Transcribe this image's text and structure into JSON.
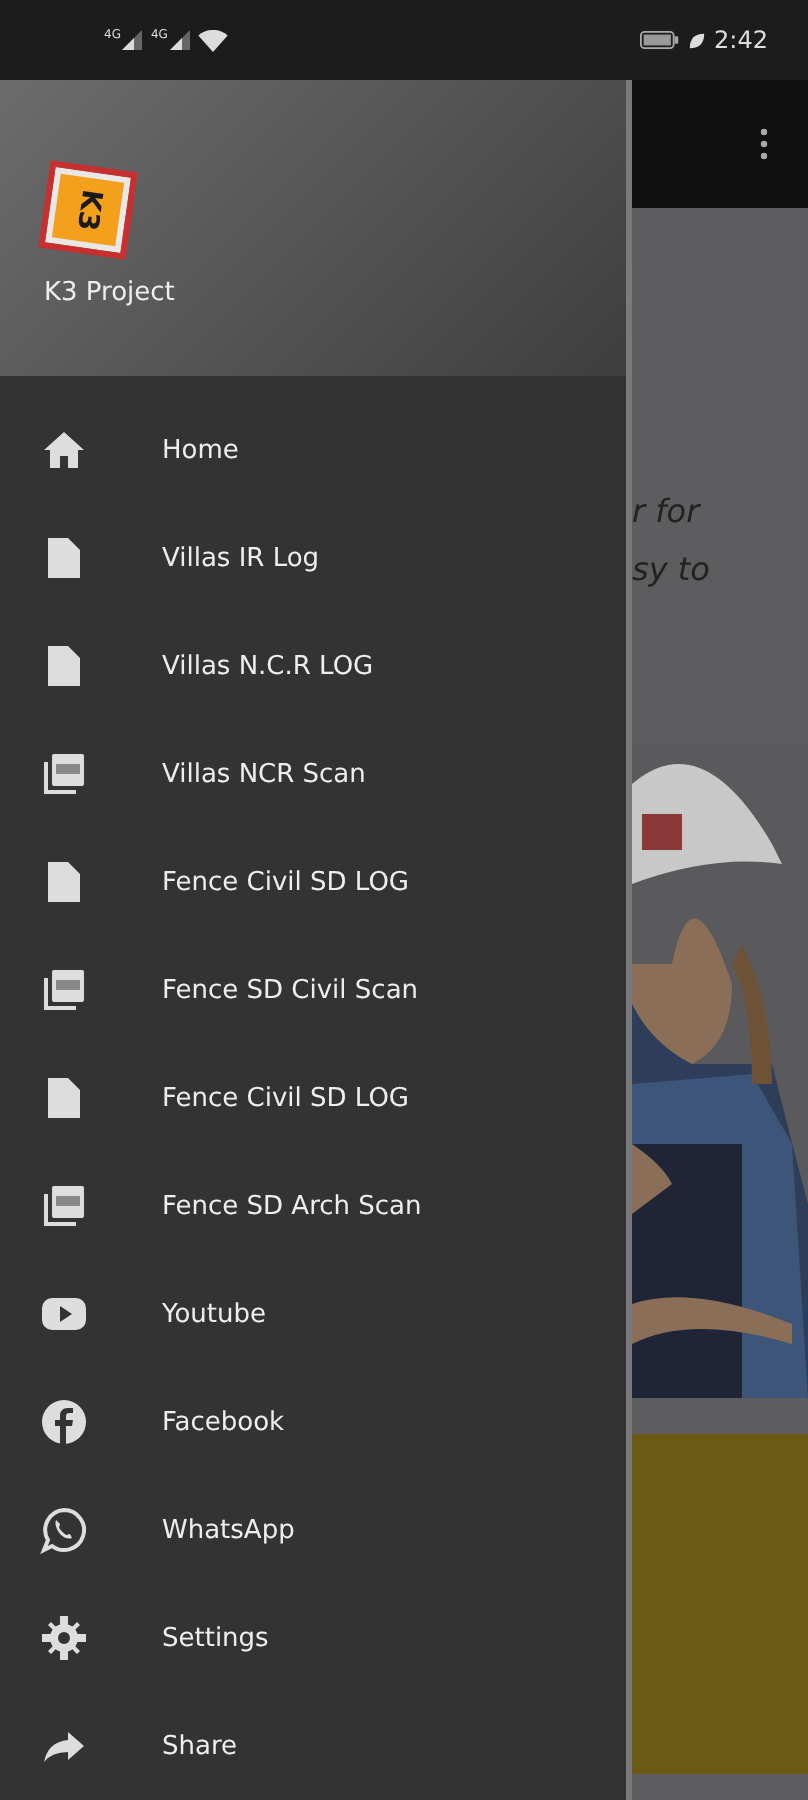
{
  "status_bar": {
    "signals": [
      "4G",
      "4G"
    ],
    "time": "2:42"
  },
  "drawer": {
    "app_name": "K3 Project",
    "logo_text": "K3",
    "items": [
      {
        "kind": "home",
        "label": "Home"
      },
      {
        "kind": "doc",
        "label": "Villas IR Log"
      },
      {
        "kind": "doc",
        "label": "Villas N.C.R LOG"
      },
      {
        "kind": "pdf",
        "label": "Villas NCR Scan"
      },
      {
        "kind": "doc",
        "label": "Fence Civil SD LOG"
      },
      {
        "kind": "pdf",
        "label": "Fence SD Civil Scan"
      },
      {
        "kind": "doc",
        "label": "Fence Civil SD LOG"
      },
      {
        "kind": "pdf",
        "label": "Fence SD Arch Scan"
      },
      {
        "kind": "youtube",
        "label": "Youtube"
      },
      {
        "kind": "facebook",
        "label": "Facebook"
      },
      {
        "kind": "whatsapp",
        "label": "WhatsApp"
      },
      {
        "kind": "settings",
        "label": "Settings"
      },
      {
        "kind": "share",
        "label": "Share"
      }
    ]
  },
  "background_screen": {
    "text_lines": [
      "r for",
      "sy to"
    ]
  }
}
